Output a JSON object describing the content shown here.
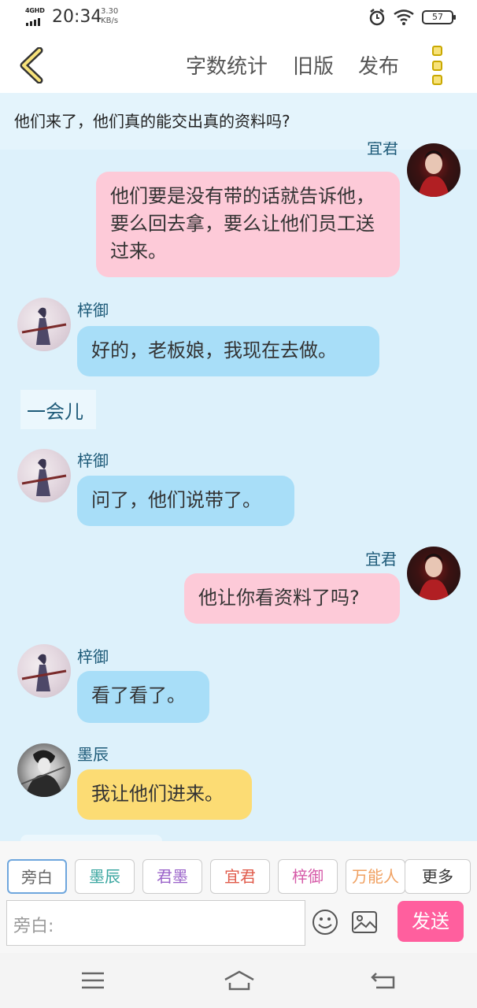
{
  "status_bar": {
    "network": "4GHD",
    "time": "20:34",
    "speed_value": "3.30",
    "speed_unit": "KB/s",
    "battery": "57"
  },
  "toolbar": {
    "word_count": "字数统计",
    "old_version": "旧版",
    "publish": "发布"
  },
  "topic": "他们来了，他们真的能交出真的资料吗?",
  "messages": [
    {
      "side": "right",
      "name": "宜君",
      "text": "他们要是没有带的话就告诉他，要么回去拿，要么让他们员工送过来。",
      "color": "pink"
    },
    {
      "side": "left",
      "name": "梓御",
      "text": "好的，老板娘，我现在去做。",
      "color": "blue"
    },
    {
      "side": "narration",
      "text": "一会儿"
    },
    {
      "side": "left",
      "name": "梓御",
      "text": "问了，他们说带了。",
      "color": "blue"
    },
    {
      "side": "right",
      "name": "宜君",
      "text": "他让你看资料了吗?",
      "color": "pink"
    },
    {
      "side": "left",
      "name": "梓御",
      "text": "看了看了。",
      "color": "blue"
    },
    {
      "side": "left",
      "name": "墨辰",
      "text": "我让他们进来。",
      "color": "yellow"
    }
  ],
  "roles": [
    {
      "label": "旁白",
      "color": "#666666",
      "active": true
    },
    {
      "label": "墨辰",
      "color": "#3aa6a0"
    },
    {
      "label": "君墨",
      "color": "#9a63c9"
    },
    {
      "label": "宜君",
      "color": "#e05a4a"
    },
    {
      "label": "梓御",
      "color": "#d65aa8"
    },
    {
      "label": "万能人",
      "color": "#f0a060"
    }
  ],
  "more_label": "更多",
  "input": {
    "placeholder": "旁白:"
  },
  "send_label": "发送",
  "colors": {
    "chat_bg": "#ddf1fb",
    "bubble_blue": "#a8def8",
    "bubble_pink": "#fdcad8",
    "bubble_yellow": "#fcdc74",
    "send_button": "#ff5f9e",
    "accent_yellow": "#f7e27a"
  }
}
